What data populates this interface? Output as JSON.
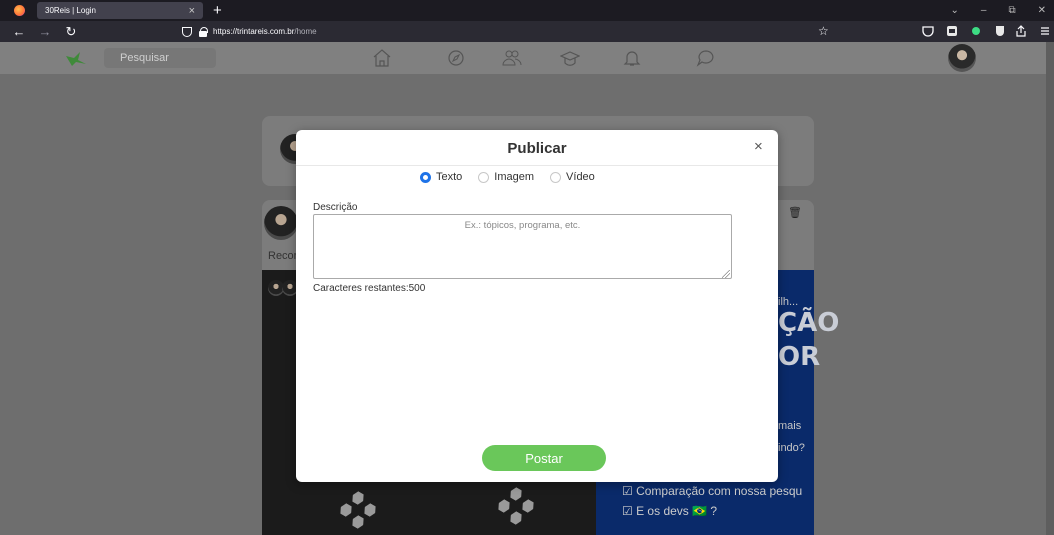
{
  "browser": {
    "tab_title": "30Reis | Login",
    "tab_close": "×",
    "new_tab": "+",
    "url_domain": "https://trintareis.com.br",
    "url_path": "/home",
    "accent": "#1c1b22"
  },
  "header": {
    "search_label": "Pesquisar",
    "nav_icons": [
      "home-icon",
      "compass-icon",
      "people-icon",
      "graduation-cap-icon",
      "bell-icon",
      "chat-icon"
    ]
  },
  "background_post": {
    "label": "Recor",
    "video_lines": [
      "ilh...",
      "ÇÃO",
      "OR",
      "mais",
      "indo?"
    ],
    "checks": [
      "Comparação com nossa pesqu",
      "E os devs 🇧🇷 ?"
    ]
  },
  "modal": {
    "title": "Publicar",
    "close": "×",
    "options": [
      {
        "label": "Texto",
        "selected": true
      },
      {
        "label": "Imagem",
        "selected": false
      },
      {
        "label": "Vídeo",
        "selected": false
      }
    ],
    "description_label": "Descrição",
    "description_placeholder": "Ex.: tópicos, programa, etc.",
    "remaining_text": "Caracteres restantes:500",
    "submit_label": "Postar",
    "submit_color": "#6ac75a",
    "radio_accent": "#1e73e8"
  }
}
